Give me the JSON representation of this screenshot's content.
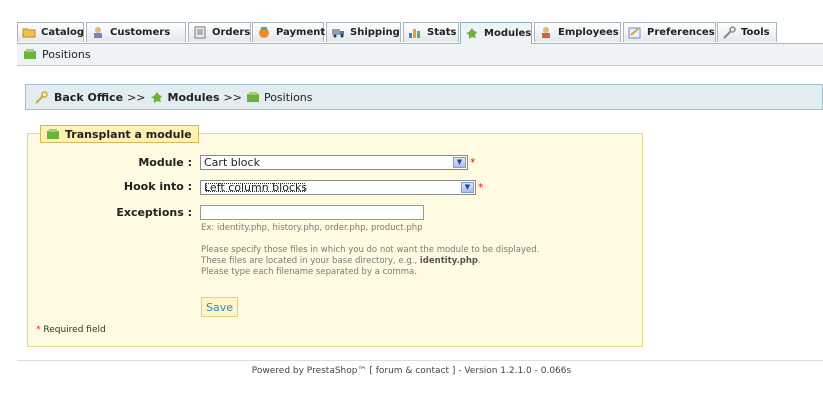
{
  "tabs": [
    {
      "label": "Catalog",
      "icon": "folder-icon"
    },
    {
      "label": "Customers",
      "icon": "customers-icon"
    },
    {
      "label": "Orders",
      "icon": "orders-icon"
    },
    {
      "label": "Payment",
      "icon": "payment-icon"
    },
    {
      "label": "Shipping",
      "icon": "shipping-icon"
    },
    {
      "label": "Stats",
      "icon": "stats-icon"
    },
    {
      "label": "Modules",
      "icon": "modules-icon",
      "active": true
    },
    {
      "label": "Employees",
      "icon": "employees-icon"
    },
    {
      "label": "Preferences",
      "icon": "preferences-icon"
    },
    {
      "label": "Tools",
      "icon": "tools-icon"
    }
  ],
  "subtab": {
    "label": "Positions"
  },
  "breadcrumb": {
    "root": "Back Office",
    "separator": ">>",
    "section": "Modules",
    "page": "Positions"
  },
  "form": {
    "legend": "Transplant a module",
    "module_label": "Module :",
    "module_value": "Cart block",
    "hook_label": "Hook into :",
    "hook_value": "Left column blocks",
    "exceptions_label": "Exceptions :",
    "exceptions_value": "",
    "example": "Ex: identity.php, history.php, order.php, product.php",
    "help_line1": "Please specify those files in which you do not want the module to be displayed.",
    "help_line2_prefix": "These files are located in your base directory, e.g., ",
    "help_line2_bold": "identity.php",
    "help_line2_suffix": ".",
    "help_line3": "Please type each filename separated by a comma.",
    "save_label": "Save",
    "required_star": "*",
    "required_note": "Required field"
  },
  "footer": {
    "text": "Powered by PrestaShop™ [ forum & contact ] - Version 1.2.1.0 - 0.066s"
  },
  "colors": {
    "tab_active_bg": "#eef4f6",
    "path_bg": "#e2edf1",
    "form_bg": "#fffbe3",
    "required": "#e02020",
    "save_text": "#268ccd"
  }
}
